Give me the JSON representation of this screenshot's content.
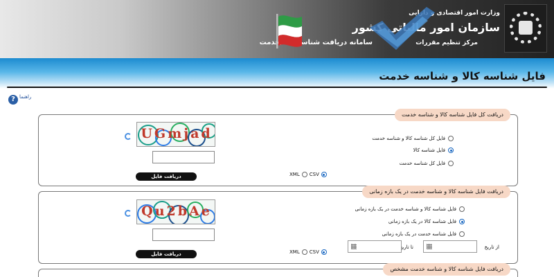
{
  "header": {
    "ministry": "وزارت امور اقتصادی و دارایی",
    "organization": "سازمان امور مالیاتی کشور",
    "center": "مرکز تنظیم مقررات",
    "system_name": "سامانه دریافت شناسه کالا/خدمت"
  },
  "page": {
    "title": "فایل شناسه کالا و شناسه خدمت",
    "help": "راهنما"
  },
  "sections": [
    {
      "legend": "دریافت کل فایل شناسه کالا و شناسه خدمت",
      "options": [
        {
          "label": "فایل کل شناسه کالا و شناسه خدمت",
          "selected": false
        },
        {
          "label": "فایل شناسه کالا",
          "selected": true
        },
        {
          "label": "فایل کل شناسه خدمت",
          "selected": false
        }
      ],
      "format": {
        "xml": "XML",
        "csv": "CSV",
        "selected": "CSV"
      },
      "captcha": "UGmjad",
      "button": "دریافت فایل"
    },
    {
      "legend": "دریافت فایل شناسه کالا و شناسه خدمت در یک بازه زمانی",
      "options": [
        {
          "label": "فایل شناسه کالا و شناسه خدمت در یک بازه زمانی",
          "selected": false
        },
        {
          "label": "فایل شناسه کالا در یک بازه زمانی",
          "selected": true
        },
        {
          "label": "فایل شناسه خدمت در یک بازه زمانی",
          "selected": false
        }
      ],
      "date_from": "از تاریخ",
      "date_to": "تا تاریخ",
      "format": {
        "xml": "XML",
        "csv": "CSV",
        "selected": "CSV"
      },
      "captcha": "Qu2bAe",
      "button": "دریافت فایل"
    },
    {
      "legend": "دریافت فایل شناسه کالا و شناسه خدمت مشخص"
    }
  ],
  "colors": {
    "legend_bg": "#f7d8c6",
    "band_blue": "#1c8bd0",
    "radio_selected": "#1565c0",
    "captcha_text": "#c0392b"
  }
}
